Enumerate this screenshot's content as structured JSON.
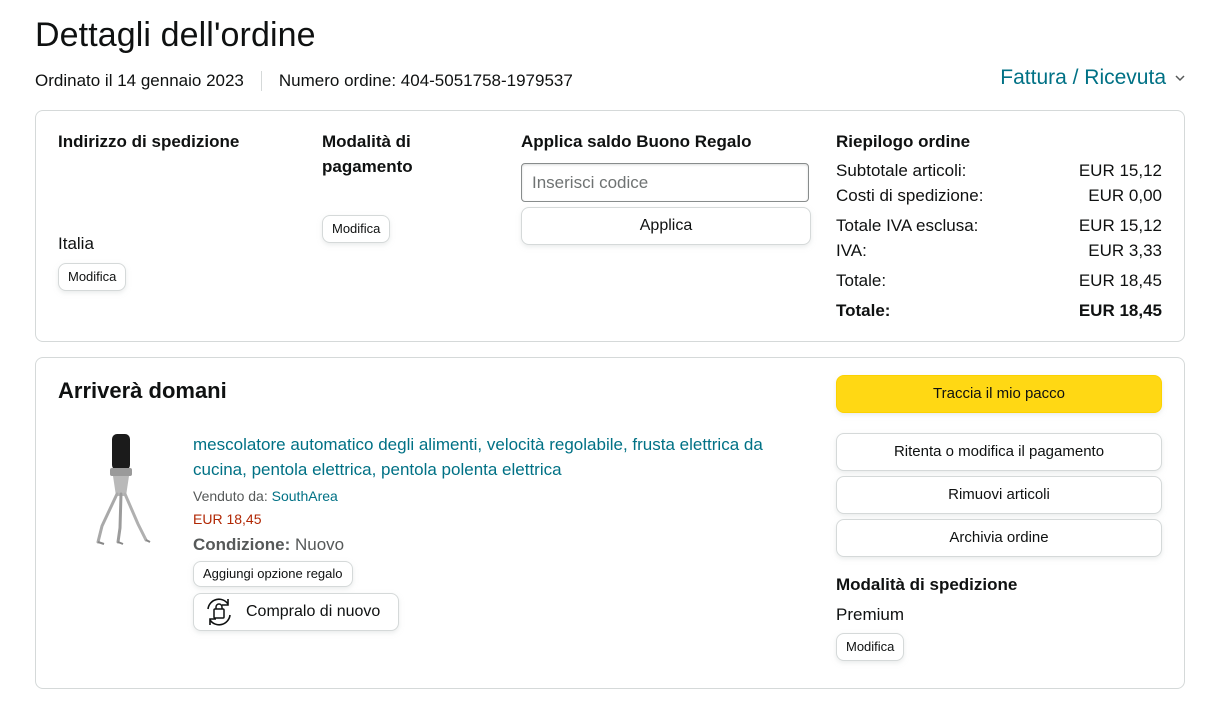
{
  "header": {
    "title": "Dettagli dell'ordine",
    "order_date": "Ordinato il 14 gennaio 2023",
    "order_number": "Numero ordine: 404-5051758-1979537",
    "invoice_label": "Fattura / Ricevuta"
  },
  "shipping_address": {
    "title": "Indirizzo di spedizione",
    "country": "Italia",
    "edit_label": "Modifica"
  },
  "payment": {
    "title": "Modalità di pagamento",
    "edit_label": "Modifica"
  },
  "gift_card": {
    "title": "Applica saldo Buono Regalo",
    "placeholder": "Inserisci codice",
    "apply_label": "Applica"
  },
  "summary": {
    "title": "Riepilogo ordine",
    "rows": [
      {
        "label": "Subtotale articoli:",
        "value": "EUR 15,12"
      },
      {
        "label": "Costi di spedizione:",
        "value": "EUR 0,00"
      },
      {
        "label": "Totale IVA esclusa:",
        "value": "EUR 15,12"
      },
      {
        "label": "IVA:",
        "value": "EUR 3,33"
      },
      {
        "label": "Totale:",
        "value": "EUR 18,45"
      },
      {
        "label": "Totale:",
        "value": "EUR 18,45"
      }
    ]
  },
  "shipment": {
    "status": "Arriverà domani",
    "product": {
      "title": "mescolatore automatico degli alimenti, velocità regolabile, frusta elettrica da cucina, pentola elettrica, pentola polenta elettrica",
      "sold_by_label": "Venduto da:",
      "seller": "SouthArea",
      "price": "EUR 18,45",
      "condition_label": "Condizione:",
      "condition_value": "Nuovo",
      "gift_option_label": "Aggiungi opzione regalo",
      "buy_again_label": "Compralo di nuovo"
    },
    "actions": {
      "track": "Traccia il mio pacco",
      "retry_payment": "Ritenta o modifica il pagamento",
      "remove_items": "Rimuovi articoli",
      "archive": "Archivia ordine"
    },
    "shipping_method": {
      "title": "Modalità di spedizione",
      "value": "Premium",
      "edit_label": "Modifica"
    }
  },
  "colors": {
    "link": "#007185",
    "price": "#B12704",
    "primary_button": "#FFD814",
    "border": "#D5D9D9"
  }
}
